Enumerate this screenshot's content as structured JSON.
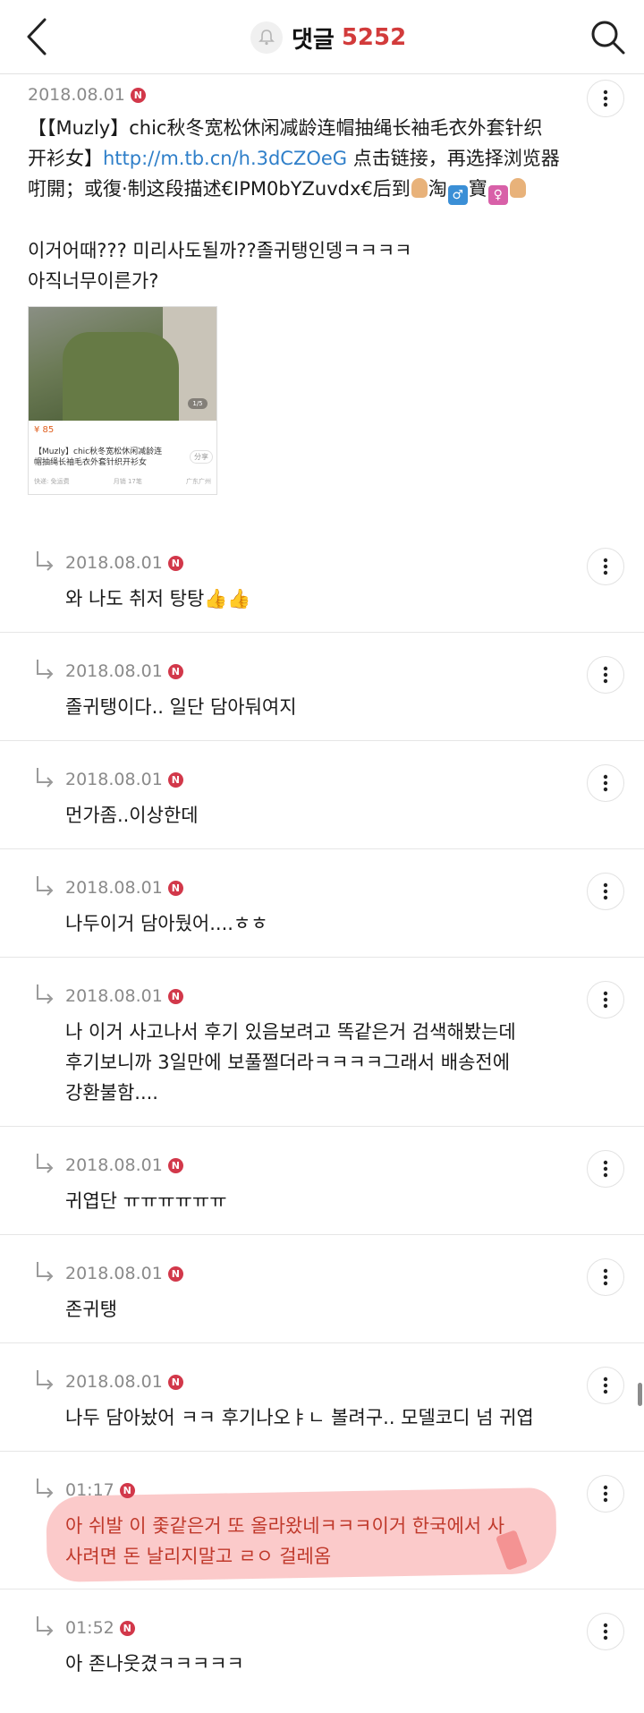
{
  "header": {
    "title": "댓글",
    "count": "5252"
  },
  "main_comment": {
    "date": "2018.08.01",
    "badge": "N",
    "line1": "【【Muzly】chic秋冬宽松休闲减龄连帽抽绳长袖毛衣外套针织",
    "line2_prefix": "开衫女】",
    "link": "http://m.tb.cn/h.3dCZOeG",
    "line2_suffix": " 点击链接，再选择浏览器",
    "line3": "咑開；或復·制这段描述€IPM0bYZuvdx€后到",
    "emoji_text_1": "淘",
    "emoji_text_2": "寶",
    "korean_line1": "이거어때??? 미리사도될까??졸귀탱인뎅ㅋㅋㅋㅋ",
    "korean_line2": "아직너무이른가?",
    "product": {
      "price": "¥ 85",
      "title": "【Muzly】chic秋冬宽松休闲减龄连帽抽绳长袖毛衣外套针织开衫女",
      "share": "分享",
      "meta_left": "快递: 免运费",
      "meta_mid": "月销 17笔",
      "meta_right": "广东广州",
      "pager": "1/5"
    }
  },
  "replies": [
    {
      "date": "2018.08.01",
      "badge": "N",
      "text": "와 나도 취저 탕탕👍👍"
    },
    {
      "date": "2018.08.01",
      "badge": "N",
      "text": "졸귀탱이다.. 일단 담아둬여지"
    },
    {
      "date": "2018.08.01",
      "badge": "N",
      "text": "먼가좀..이상한데"
    },
    {
      "date": "2018.08.01",
      "badge": "N",
      "text": "나두이거 담아뒀어....ㅎㅎ"
    },
    {
      "date": "2018.08.01",
      "badge": "N",
      "text": "나 이거 사고나서 후기 있음보려고 똑같은거 검색해봤는데\n후기보니까 3일만에 보풀쩔더라ㅋㅋㅋㅋ그래서 배송전에\n강환불함...."
    },
    {
      "date": "2018.08.01",
      "badge": "N",
      "text": "귀엽단 ㅠㅠㅠㅠㅠㅠ"
    },
    {
      "date": "2018.08.01",
      "badge": "N",
      "text": "존귀탱"
    },
    {
      "date": "2018.08.01",
      "badge": "N",
      "text": "나두 담아놨어 ㅋㅋ 후기나오ㅑㄴ 볼려구.. 모델코디 넘 귀엽"
    },
    {
      "date": "01:17",
      "badge": "N",
      "text": "아 쉬발 이 좇같은거 또 올라왔네ㅋㅋㅋ이거 한국에서 사\n사려면 돈 날리지말고 ㄹㅇ 걸레옴"
    },
    {
      "date": "01:52",
      "badge": "N",
      "text": "아 존나웃겼ㅋㅋㅋㅋㅋ"
    }
  ],
  "colors": {
    "accent": "#d23b3b",
    "badge": "#d2384a",
    "link": "#2f7fc9",
    "highlight": "#f79e9e"
  },
  "icons": {
    "back": "chevron-left-icon",
    "bell": "bell-icon",
    "search": "search-icon",
    "more": "more-vertical-icon",
    "reply": "reply-arrow-icon"
  }
}
